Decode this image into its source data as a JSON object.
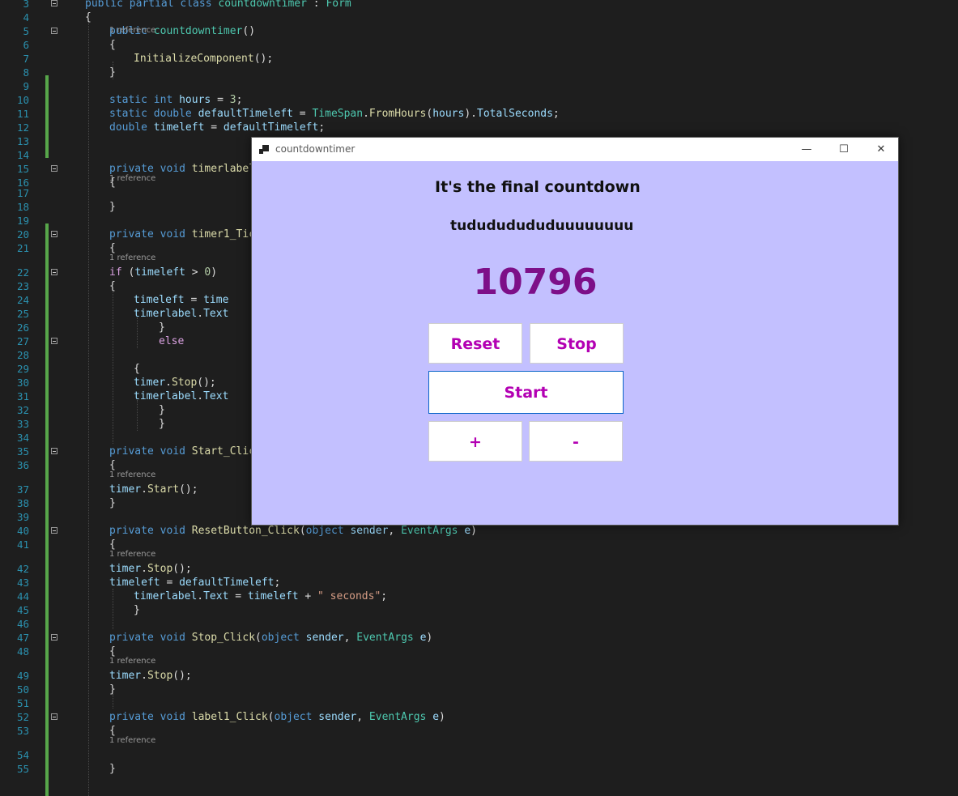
{
  "editor": {
    "reference_label": "1 reference",
    "lines": [
      {
        "n": "3",
        "code": "<span class='kw'>public partial class</span> <span class='ty'>countdowntimer</span> : <span class='ty'>Form</span>"
      },
      {
        "n": "4",
        "code": "{"
      },
      {
        "n": "5",
        "code": "<span class='kw'>public</span> <span class='ty'>countdowntimer</span>()"
      },
      {
        "n": "6",
        "code": "{"
      },
      {
        "n": "7",
        "code": "<span class='fn'>InitializeComponent</span>();"
      },
      {
        "n": "8",
        "code": "}"
      },
      {
        "n": "9",
        "code": ""
      },
      {
        "n": "10",
        "code": "<span class='kw'>static int</span> <span class='var'>hours</span> = <span class='num'>3</span>;"
      },
      {
        "n": "11",
        "code": "<span class='kw'>static double</span> <span class='var'>defaultTimeleft</span> = <span class='ty'>TimeSpan</span>.<span class='fn'>FromHours</span>(<span class='var'>hours</span>).<span class='var'>TotalSeconds</span>;"
      },
      {
        "n": "12",
        "code": "<span class='kw'>double</span> <span class='var'>timeleft</span> = <span class='var'>defaultTimeleft</span>;"
      },
      {
        "n": "13",
        "code": ""
      },
      {
        "n": "14",
        "code": ""
      },
      {
        "n": "15",
        "code": "<span class='kw'>private void</span> <span class='fn'>timerlabel</span>"
      },
      {
        "n": "16",
        "code": "{"
      },
      {
        "n": "17",
        "code": ""
      },
      {
        "n": "18",
        "code": "}"
      },
      {
        "n": "19",
        "code": ""
      },
      {
        "n": "20",
        "code": "<span class='kw'>private void</span> <span class='fn'>timer1_Tic</span>"
      },
      {
        "n": "21",
        "code": "{"
      },
      {
        "n": "22",
        "code": "<span class='ctl'>if</span> (<span class='var'>timeleft</span> &gt; <span class='num'>0</span>)"
      },
      {
        "n": "23",
        "code": "{"
      },
      {
        "n": "24",
        "code": "<span class='var'>timeleft</span> = <span class='var'>time</span>"
      },
      {
        "n": "25",
        "code": "<span class='var'>timerlabel</span>.<span class='var'>Text</span>"
      },
      {
        "n": "26",
        "code": "}"
      },
      {
        "n": "27",
        "code": "<span class='ctl'>else</span>"
      },
      {
        "n": "28",
        "code": ""
      },
      {
        "n": "29",
        "code": "{"
      },
      {
        "n": "30",
        "code": "<span class='var'>timer</span>.<span class='fn'>Stop</span>();"
      },
      {
        "n": "31",
        "code": "<span class='var'>timerlabel</span>.<span class='var'>Text</span>"
      },
      {
        "n": "32",
        "code": "}"
      },
      {
        "n": "33",
        "code": "}"
      },
      {
        "n": "34",
        "code": ""
      },
      {
        "n": "35",
        "code": "<span class='kw'>private void</span> <span class='fn'>Start_Clic</span>"
      },
      {
        "n": "36",
        "code": "{"
      },
      {
        "n": "37",
        "code": "<span class='var'>timer</span>.<span class='fn'>Start</span>();"
      },
      {
        "n": "38",
        "code": "}"
      },
      {
        "n": "39",
        "code": ""
      },
      {
        "n": "40",
        "code": "<span class='kw'>private void</span> <span class='fn'>ResetButton_Click</span>(<span class='kw'>object</span> <span class='var'>sender</span>, <span class='ty'>EventArgs</span> <span class='var'>e</span>)"
      },
      {
        "n": "41",
        "code": "{"
      },
      {
        "n": "42",
        "code": "<span class='var'>timer</span>.<span class='fn'>Stop</span>();"
      },
      {
        "n": "43",
        "code": "<span class='var'>timeleft</span> = <span class='var'>defaultTimeleft</span>;"
      },
      {
        "n": "44",
        "code": "<span class='var'>timerlabel</span>.<span class='var'>Text</span> = <span class='var'>timeleft</span> + <span class='str'>\" seconds\"</span>;"
      },
      {
        "n": "45",
        "code": "}"
      },
      {
        "n": "46",
        "code": ""
      },
      {
        "n": "47",
        "code": "<span class='kw'>private void</span> <span class='fn'>Stop_Click</span>(<span class='kw'>object</span> <span class='var'>sender</span>, <span class='ty'>EventArgs</span> <span class='var'>e</span>)"
      },
      {
        "n": "48",
        "code": "{"
      },
      {
        "n": "49",
        "code": "<span class='var'>timer</span>.<span class='fn'>Stop</span>();"
      },
      {
        "n": "50",
        "code": "}"
      },
      {
        "n": "51",
        "code": ""
      },
      {
        "n": "52",
        "code": "<span class='kw'>private void</span> <span class='fn'>label1_Click</span>(<span class='kw'>object</span> <span class='var'>sender</span>, <span class='ty'>EventArgs</span> <span class='var'>e</span>)"
      },
      {
        "n": "53",
        "code": "{"
      },
      {
        "n": "54",
        "code": ""
      },
      {
        "n": "55",
        "code": "}"
      }
    ]
  },
  "window": {
    "title": "countdowntimer",
    "minimize_glyph": "—",
    "maximize_glyph": "☐",
    "close_glyph": "✕",
    "heading": "It's the final countdown",
    "subheading": "tudududududuuuuuuuu",
    "countdown_value": "10796",
    "buttons": {
      "reset": "Reset",
      "stop": "Stop",
      "start": "Start",
      "plus": "+",
      "minus": "-"
    },
    "colors": {
      "form_background": "#c3c0ff",
      "button_text": "#b300b3",
      "countdown_text": "#7d0f88"
    }
  }
}
